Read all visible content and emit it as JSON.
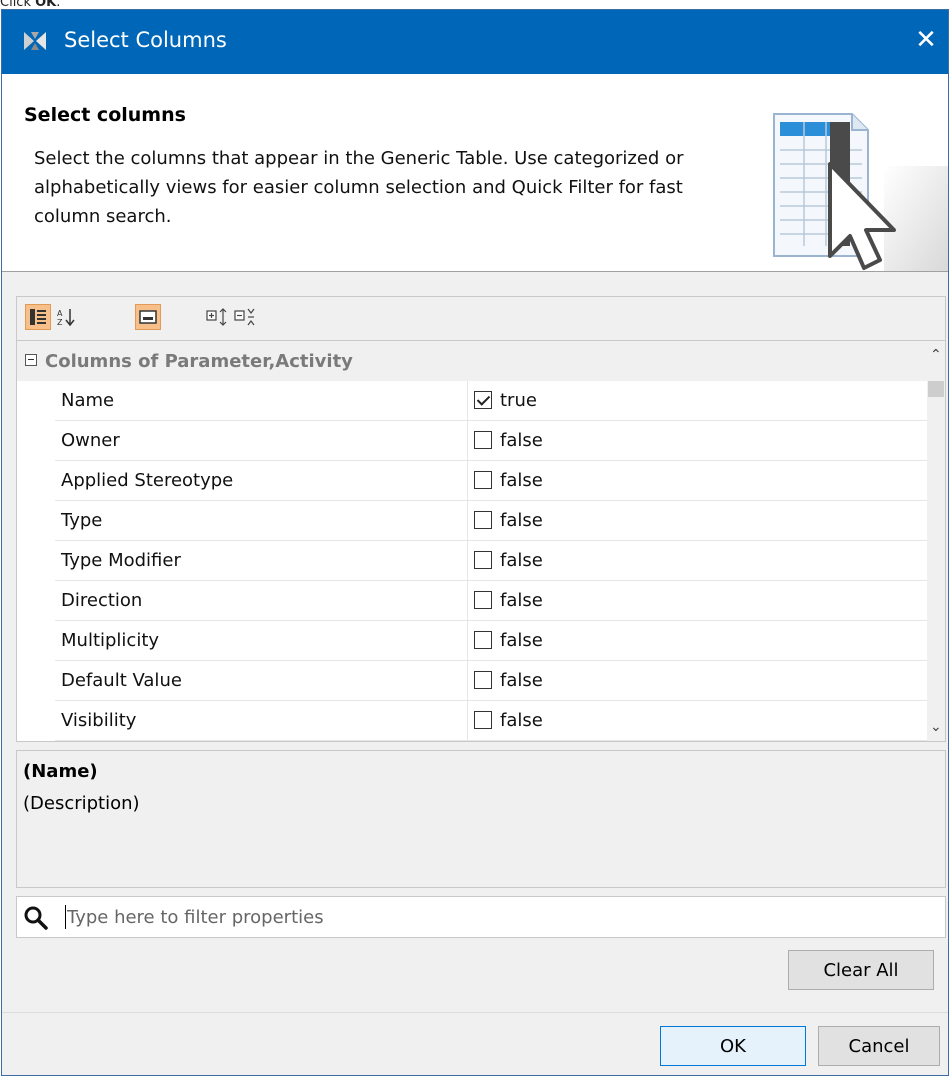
{
  "caption": {
    "prefix": "Click ",
    "bold": "OK",
    "suffix": "."
  },
  "window": {
    "title": "Select Columns",
    "close_glyph": "✕"
  },
  "header": {
    "title": "Select columns",
    "description": "Select the columns that appear in the Generic Table. Use categorized or alphabetically views for easier column selection and Quick Filter for fast column search."
  },
  "toolbar": {
    "buttons": [
      {
        "name": "categorized-view-icon",
        "active": true
      },
      {
        "name": "alphabetical-sort-icon",
        "active": false
      },
      {
        "name": "show-description-icon",
        "active": true
      },
      {
        "name": "expand-all-icon",
        "active": false
      },
      {
        "name": "collapse-all-icon",
        "active": false
      }
    ]
  },
  "grid": {
    "group": "Columns of Parameter,Activity",
    "rows": [
      {
        "name": "Name",
        "checked": true,
        "value": "true"
      },
      {
        "name": "Owner",
        "checked": false,
        "value": "false"
      },
      {
        "name": "Applied Stereotype",
        "checked": false,
        "value": "false"
      },
      {
        "name": "Type",
        "checked": false,
        "value": "false"
      },
      {
        "name": "Type Modifier",
        "checked": false,
        "value": "false"
      },
      {
        "name": "Direction",
        "checked": false,
        "value": "false"
      },
      {
        "name": "Multiplicity",
        "checked": false,
        "value": "false"
      },
      {
        "name": "Default Value",
        "checked": false,
        "value": "false"
      },
      {
        "name": "Visibility",
        "checked": false,
        "value": "false"
      }
    ]
  },
  "description_pane": {
    "name": "(Name)",
    "description": "(Description)"
  },
  "filter": {
    "placeholder": "Type here to filter properties",
    "value": ""
  },
  "buttons": {
    "clear_all": "Clear All",
    "ok": "OK",
    "cancel": "Cancel"
  },
  "colors": {
    "title_bar": "#0067b8",
    "active_tool": "#f7c08a",
    "default_button_border": "#0078d7"
  }
}
